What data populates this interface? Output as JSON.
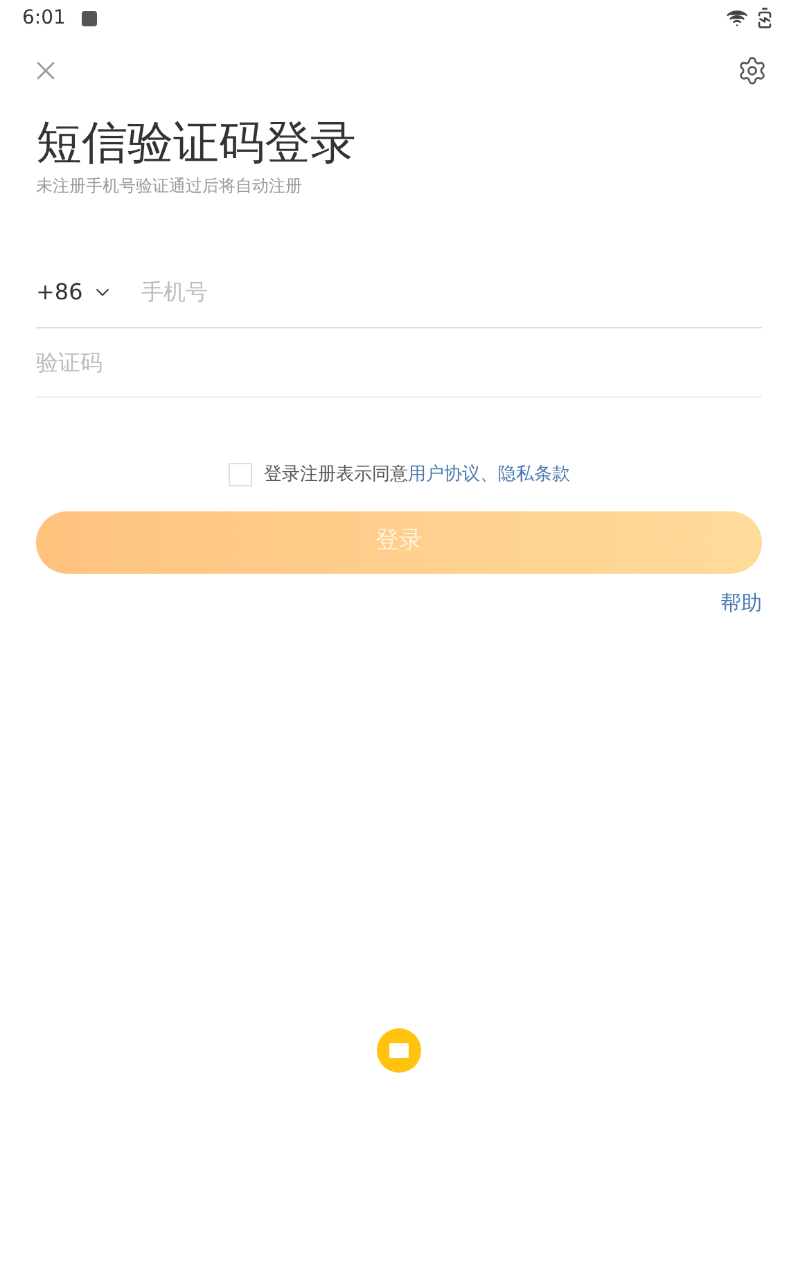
{
  "status_bar": {
    "time": "6:01"
  },
  "title": "短信验证码登录",
  "subtitle": "未注册手机号验证通过后将自动注册",
  "phone": {
    "country_code": "+86",
    "placeholder": "手机号"
  },
  "code": {
    "placeholder": "验证码"
  },
  "agreement": {
    "checked": false,
    "text": "登录注册表示同意",
    "links": [
      "用户协议",
      "隐私条款"
    ],
    "separator": "、"
  },
  "login_button": {
    "label": "登录",
    "disabled": true
  },
  "help": "帮助"
}
